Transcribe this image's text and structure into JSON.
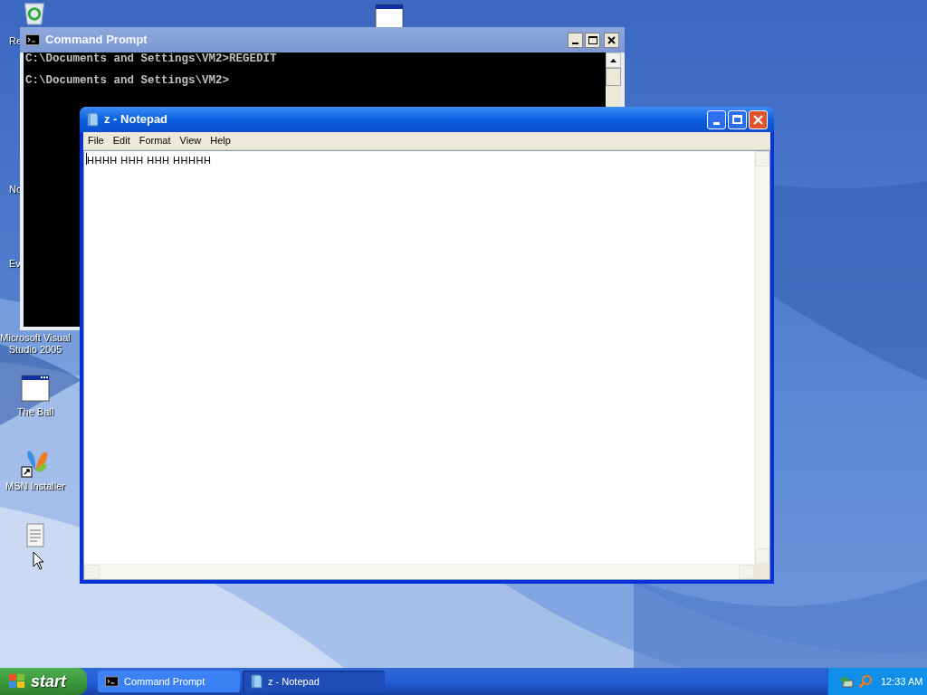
{
  "desktop_icons": [
    {
      "label": "Re",
      "kind": "recycle"
    },
    {
      "label": "No",
      "kind": "none"
    },
    {
      "label": "Ev",
      "kind": "none"
    },
    {
      "label": "Microsoft Visual Studio 2005",
      "kind": "none"
    },
    {
      "label": "The Ball",
      "kind": "app-window"
    },
    {
      "label": "MSN Installer",
      "kind": "butterfly"
    }
  ],
  "windows": [
    {
      "kind": "console",
      "title": "Command Prompt",
      "active": false,
      "lines": [
        "C:\\Documents and Settings\\VM2>REGEDIT",
        "C:\\Documents and Settings\\VM2>"
      ]
    },
    {
      "kind": "notepad",
      "title": "z - Notepad",
      "active": true,
      "menu": [
        "File",
        "Edit",
        "Format",
        "View",
        "Help"
      ],
      "text": "HHHH HHH HHH HHHHH"
    }
  ],
  "taskbar": {
    "start": "start",
    "buttons": [
      {
        "label": "Command Prompt",
        "kind": "console",
        "selected": false
      },
      {
        "label": "z - Notepad",
        "kind": "notepad",
        "selected": true
      }
    ],
    "clock": "12:33 AM"
  }
}
